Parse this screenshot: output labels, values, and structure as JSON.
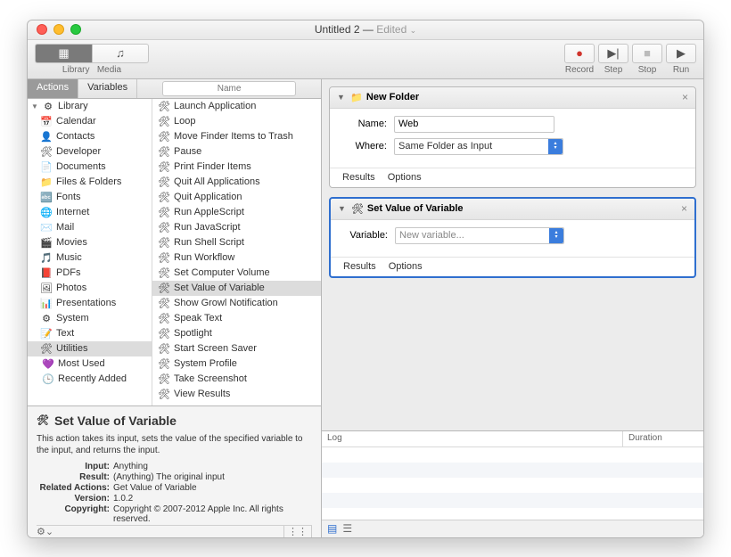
{
  "window": {
    "title": "Untitled 2",
    "status": "Edited"
  },
  "toolbar": {
    "library": "Library",
    "media": "Media",
    "record": "Record",
    "step": "Step",
    "stop": "Stop",
    "run": "Run"
  },
  "tabs": {
    "actions": "Actions",
    "variables": "Variables",
    "search_ph": "Name"
  },
  "library": {
    "root": "Library",
    "items": [
      "Calendar",
      "Contacts",
      "Developer",
      "Documents",
      "Files & Folders",
      "Fonts",
      "Internet",
      "Mail",
      "Movies",
      "Music",
      "PDFs",
      "Photos",
      "Presentations",
      "System",
      "Text",
      "Utilities"
    ],
    "extra": [
      "Most Used",
      "Recently Added"
    ],
    "selected": "Utilities"
  },
  "actions": {
    "items": [
      "Launch Application",
      "Loop",
      "Move Finder Items to Trash",
      "Pause",
      "Print Finder Items",
      "Quit All Applications",
      "Quit Application",
      "Run AppleScript",
      "Run JavaScript",
      "Run Shell Script",
      "Run Workflow",
      "Set Computer Volume",
      "Set Value of Variable",
      "Show Growl Notification",
      "Speak Text",
      "Spotlight",
      "Start Screen Saver",
      "System Profile",
      "Take Screenshot",
      "View Results"
    ],
    "selected": "Set Value of Variable"
  },
  "info": {
    "title": "Set Value of Variable",
    "desc": "This action takes its input, sets the value of the specified variable to the input, and returns the input.",
    "input_l": "Input:",
    "input_v": "Anything",
    "result_l": "Result:",
    "result_v": "(Anything) The original input",
    "related_l": "Related Actions:",
    "related_v": "Get Value of Variable",
    "version_l": "Version:",
    "version_v": "1.0.2",
    "copy_l": "Copyright:",
    "copy_v": "Copyright © 2007-2012 Apple Inc.  All rights reserved."
  },
  "wf": {
    "a1": {
      "title": "New Folder",
      "name_l": "Name:",
      "name_v": "Web",
      "where_l": "Where:",
      "where_v": "Same Folder as Input",
      "results": "Results",
      "options": "Options"
    },
    "a2": {
      "title": "Set Value of Variable",
      "var_l": "Variable:",
      "var_v": "New variable...",
      "results": "Results",
      "options": "Options"
    }
  },
  "log": {
    "col1": "Log",
    "col2": "Duration"
  }
}
